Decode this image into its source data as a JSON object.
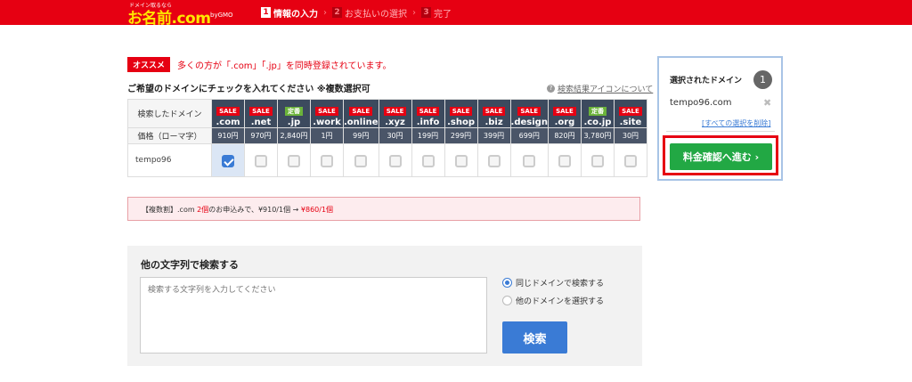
{
  "header": {
    "logo_tagline": "ドメイン取るなら",
    "logo_text": "お名前.com",
    "logo_gmo": "byGMO",
    "steps": [
      {
        "num": "1",
        "label": "情報の入力",
        "active": true
      },
      {
        "num": "2",
        "label": "お支払いの選択",
        "active": false
      },
      {
        "num": "3",
        "label": "完了",
        "active": false
      }
    ]
  },
  "recommend": {
    "tag": "オススメ",
    "message": "多くの方が「.com」「.jp」を同時登録されています。"
  },
  "instruction": "ご希望のドメインにチェックを入れてください ※複数選択可",
  "help_link": "検索結果アイコンについて",
  "table": {
    "search_label": "検索したドメイン",
    "price_label": "価格（ローマ字）",
    "domains": [
      {
        "badge": "SALE",
        "badge_type": "sale",
        "tld": ".com",
        "price": "910円",
        "checked": true
      },
      {
        "badge": "SALE",
        "badge_type": "sale",
        "tld": ".net",
        "price": "970円",
        "checked": false
      },
      {
        "badge": "定番",
        "badge_type": "fixed",
        "tld": ".jp",
        "price": "2,840円",
        "checked": false
      },
      {
        "badge": "SALE",
        "badge_type": "sale",
        "tld": ".work",
        "price": "1円",
        "checked": false
      },
      {
        "badge": "SALE",
        "badge_type": "sale",
        "tld": ".online",
        "price": "99円",
        "checked": false
      },
      {
        "badge": "SALE",
        "badge_type": "sale",
        "tld": ".xyz",
        "price": "30円",
        "checked": false
      },
      {
        "badge": "SALE",
        "badge_type": "sale",
        "tld": ".info",
        "price": "199円",
        "checked": false
      },
      {
        "badge": "SALE",
        "badge_type": "sale",
        "tld": ".shop",
        "price": "299円",
        "checked": false
      },
      {
        "badge": "SALE",
        "badge_type": "sale",
        "tld": ".biz",
        "price": "399円",
        "checked": false
      },
      {
        "badge": "SALE",
        "badge_type": "sale",
        "tld": ".design",
        "price": "699円",
        "checked": false
      },
      {
        "badge": "SALE",
        "badge_type": "sale",
        "tld": ".org",
        "price": "820円",
        "checked": false
      },
      {
        "badge": "定番",
        "badge_type": "fixed",
        "tld": ".co.jp",
        "price": "3,780円",
        "checked": false
      },
      {
        "badge": "SALE",
        "badge_type": "sale",
        "tld": ".site",
        "price": "30円",
        "checked": false
      }
    ],
    "row_name": "tempo96"
  },
  "multi_discount": {
    "prefix": "【複数割】.com ",
    "count": "2個",
    "middle": "のお申込みで、¥910/1個 → ",
    "after": "¥860/1個"
  },
  "other_search": {
    "title": "他の文字列で検索する",
    "placeholder": "検索する文字列を入力してください",
    "radio_same": "同じドメインで検索する",
    "radio_other": "他のドメインを選択する",
    "search_button": "検索"
  },
  "panel": {
    "title": "選択されたドメイン",
    "count": "1",
    "domain": "tempo96.com",
    "remove_all": "[すべての選択を削除]",
    "proceed_button": "料金確認へ進む ›"
  },
  "colors": {
    "brand_red": "#e60012",
    "table_header": "#3c4a5e",
    "primary_blue": "#3a7bd5",
    "proceed_green": "#22a844"
  }
}
